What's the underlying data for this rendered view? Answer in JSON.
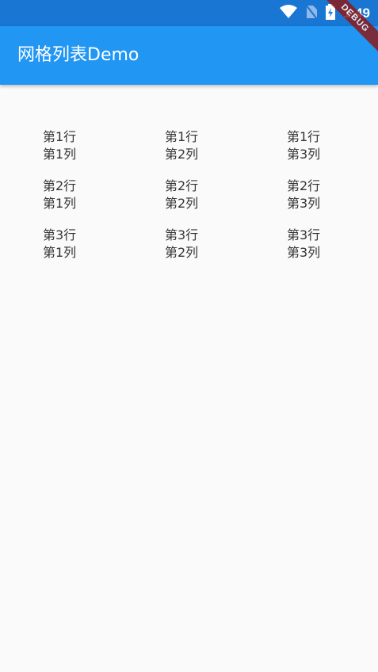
{
  "status_bar": {
    "time": "1:49",
    "icons": [
      "wifi-icon",
      "no-sim-icon",
      "battery-charging-icon"
    ]
  },
  "app_bar": {
    "title": "网格列表Demo",
    "debug_label": "DEBUG"
  },
  "grid": {
    "rows": [
      [
        {
          "line1": "第1行",
          "line2": "第1列"
        },
        {
          "line1": "第1行",
          "line2": "第2列"
        },
        {
          "line1": "第1行",
          "line2": "第3列"
        }
      ],
      [
        {
          "line1": "第2行",
          "line2": "第1列"
        },
        {
          "line1": "第2行",
          "line2": "第2列"
        },
        {
          "line1": "第2行",
          "line2": "第3列"
        }
      ],
      [
        {
          "line1": "第3行",
          "line2": "第1列"
        },
        {
          "line1": "第3行",
          "line2": "第2列"
        },
        {
          "line1": "第3行",
          "line2": "第3列"
        }
      ]
    ]
  },
  "colors": {
    "status_bar": "#1976d2",
    "app_bar": "#2196f3",
    "background": "#fafafa",
    "text": "#333333"
  }
}
